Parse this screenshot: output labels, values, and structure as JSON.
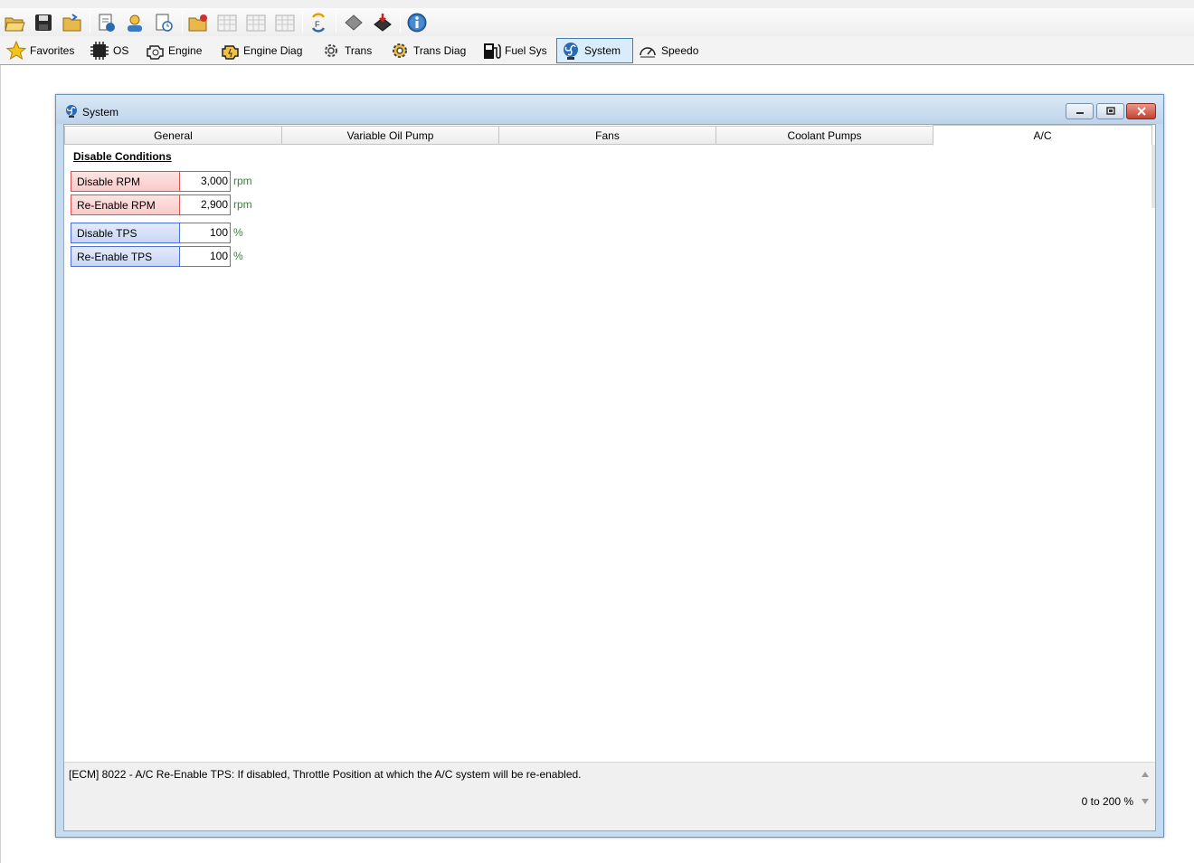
{
  "toolbar": {
    "icons": [
      "open-icon",
      "save-icon",
      "open-folder-icon",
      "file-info-icon",
      "vin-icon",
      "log-file-icon",
      "open-tune-icon",
      "table-icon",
      "table-2-icon",
      "table-3-icon",
      "compare-icon",
      "chip-read-icon",
      "chip-write-icon",
      "info-icon"
    ]
  },
  "nav": {
    "items": [
      {
        "label": "Favorites",
        "icon": "star-icon"
      },
      {
        "label": "OS",
        "icon": "chip-icon"
      },
      {
        "label": "Engine",
        "icon": "engine-icon"
      },
      {
        "label": "Engine Diag",
        "icon": "engine-diag-icon"
      },
      {
        "label": "Trans",
        "icon": "gear-icon"
      },
      {
        "label": "Trans Diag",
        "icon": "gear-diag-icon"
      },
      {
        "label": "Fuel Sys",
        "icon": "fuel-pump-icon"
      },
      {
        "label": "System",
        "icon": "fan-icon"
      },
      {
        "label": "Speedo",
        "icon": "speedometer-icon"
      }
    ],
    "active": "System"
  },
  "window": {
    "title": "System",
    "tabs": [
      "General",
      "Variable Oil Pump",
      "Fans",
      "Coolant Pumps",
      "A/C"
    ],
    "active_tab": "A/C"
  },
  "section": {
    "title": "Disable Conditions",
    "params": [
      {
        "label": "Disable RPM",
        "value": "3,000",
        "unit": "rpm",
        "color": "red"
      },
      {
        "label": "Re-Enable RPM",
        "value": "2,900",
        "unit": "rpm",
        "color": "red"
      },
      {
        "label": "Disable TPS",
        "value": "100",
        "unit": "%",
        "color": "blue"
      },
      {
        "label": "Re-Enable TPS",
        "value": "100",
        "unit": "%",
        "color": "blue"
      }
    ]
  },
  "status": {
    "description": "[ECM] 8022 - A/C Re-Enable TPS: If disabled, Throttle Position at which the A/C system will be re-enabled.",
    "range": "0 to 200 %"
  },
  "colors": {
    "active_nav_bg": "#d9ecfb",
    "unit_green": "#2e8b2e",
    "red_border": "#d9534f",
    "blue_border": "#4f6fd9"
  }
}
